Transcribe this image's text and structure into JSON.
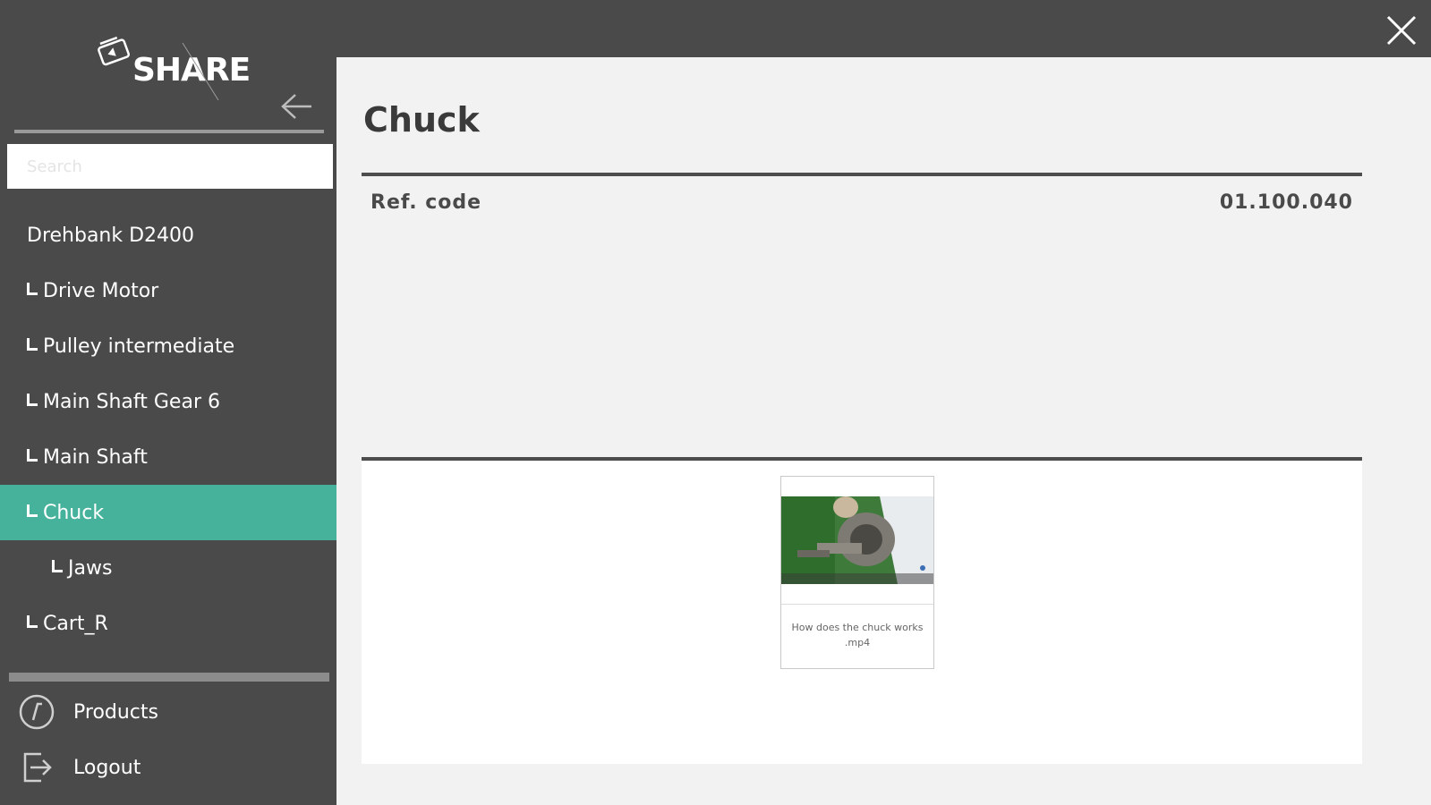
{
  "app": {
    "logo_text": "SHARE"
  },
  "sidebar": {
    "search_placeholder": "Search",
    "tree": [
      {
        "label": "Drehbank D2400",
        "level": 0,
        "active": false
      },
      {
        "label": "Drive Motor",
        "level": 1,
        "active": false
      },
      {
        "label": "Pulley intermediate",
        "level": 1,
        "active": false
      },
      {
        "label": "Main Shaft Gear 6",
        "level": 1,
        "active": false
      },
      {
        "label": "Main Shaft",
        "level": 1,
        "active": false
      },
      {
        "label": "Chuck",
        "level": 1,
        "active": true
      },
      {
        "label": "Jaws",
        "level": 2,
        "active": false
      },
      {
        "label": "Cart_R",
        "level": 1,
        "active": false
      }
    ],
    "bottom_nav": [
      {
        "label": "Products",
        "icon": "products-icon"
      },
      {
        "label": "Logout",
        "icon": "logout-icon"
      }
    ]
  },
  "main": {
    "title": "Chuck",
    "ref_label": "Ref. code",
    "ref_value": "01.100.040",
    "media": [
      {
        "caption": "How does the chuck works .mp4",
        "thumbnail": "video-thumbnail"
      }
    ]
  },
  "colors": {
    "background_dark": "#4a4a4a",
    "active_item": "#47b29c",
    "panel": "#f2f2f2"
  }
}
